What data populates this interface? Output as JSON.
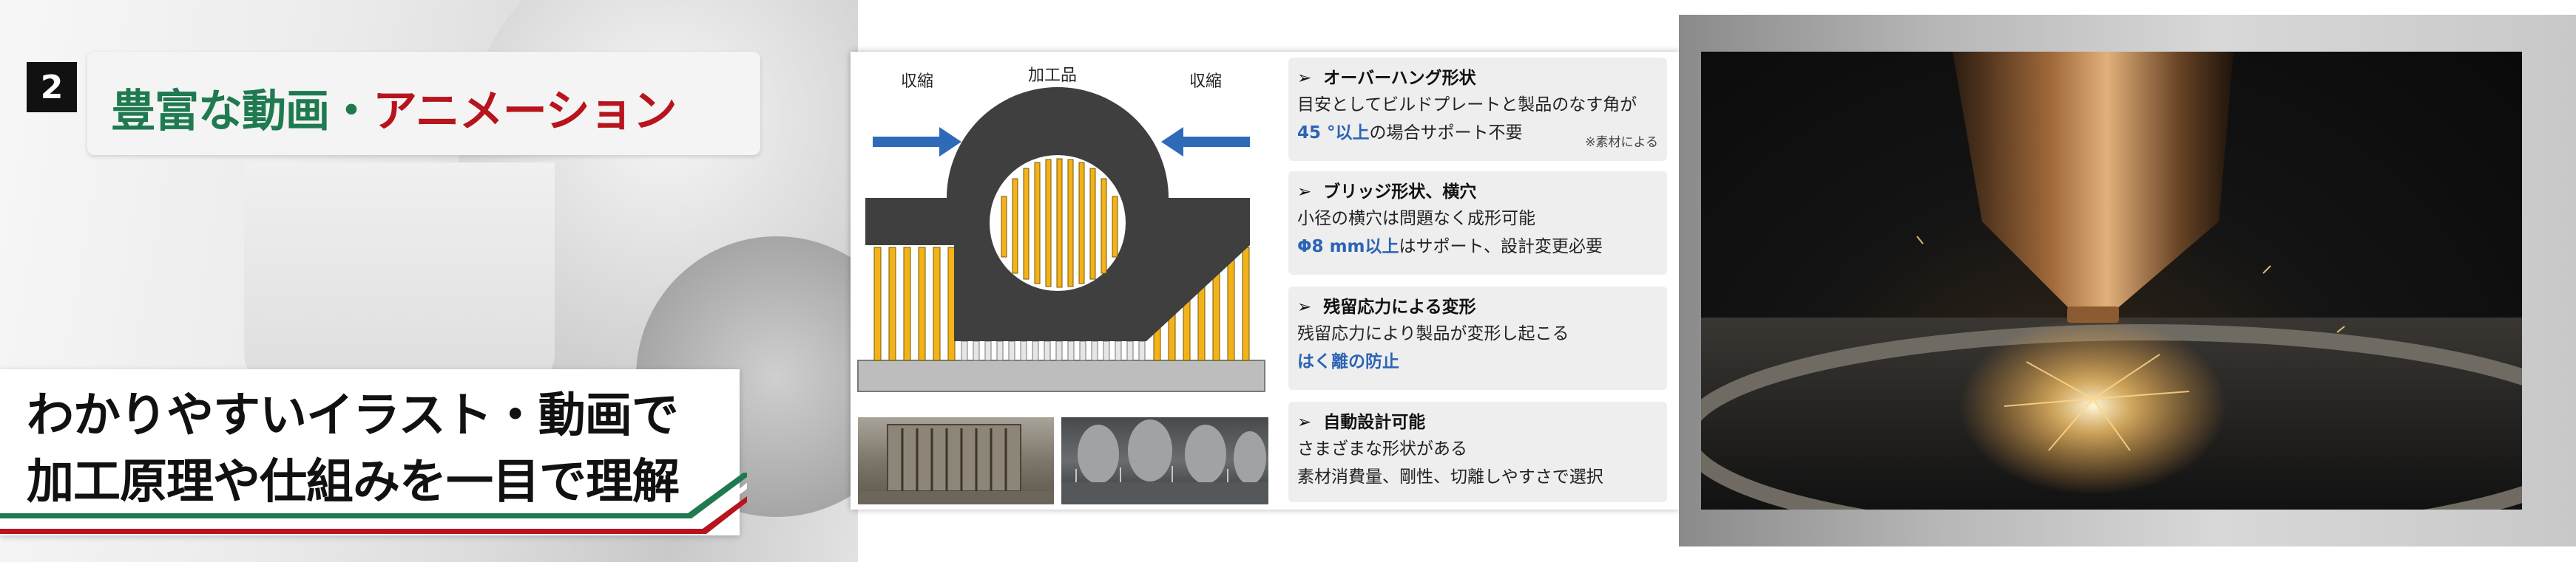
{
  "banner": {
    "number": "2",
    "title_part1": "豊富な動画・",
    "title_part2": "アニメーション",
    "subtitle_line1": "わかりやすいイラスト・動画で",
    "subtitle_line2": "加工原理や仕組みを一目で理解"
  },
  "diagram": {
    "label_left": "収縮",
    "label_center": "加工品",
    "label_right": "収縮"
  },
  "cards": [
    {
      "title": "オーバーハング形状",
      "line1": "目安としてビルドプレートと製品のなす角が",
      "line2_blue": "45 °以上",
      "line2_rest": "の場合サポート不要",
      "note": "※素材による"
    },
    {
      "title": "ブリッジ形状、横穴",
      "line1": "小径の横穴は問題なく成形可能",
      "line2_blue": "Φ8 mm以上",
      "line2_rest": "はサポート、設計変更必要"
    },
    {
      "title": "残留応力による変形",
      "line1": "残留応力により製品が変形し起こる",
      "line2_blue": "はく離の防止"
    },
    {
      "title": "自動設計可能",
      "line1": "さまざまな形状がある",
      "line2": "素材消費量、剛性、切離しやすさで選択"
    }
  ],
  "colors": {
    "title_green": "#1f7a4f",
    "title_red": "#b8141d",
    "accent_blue": "#2c63b5",
    "support_yellow": "#f2b21a",
    "part_dark": "#3f3f3f"
  }
}
